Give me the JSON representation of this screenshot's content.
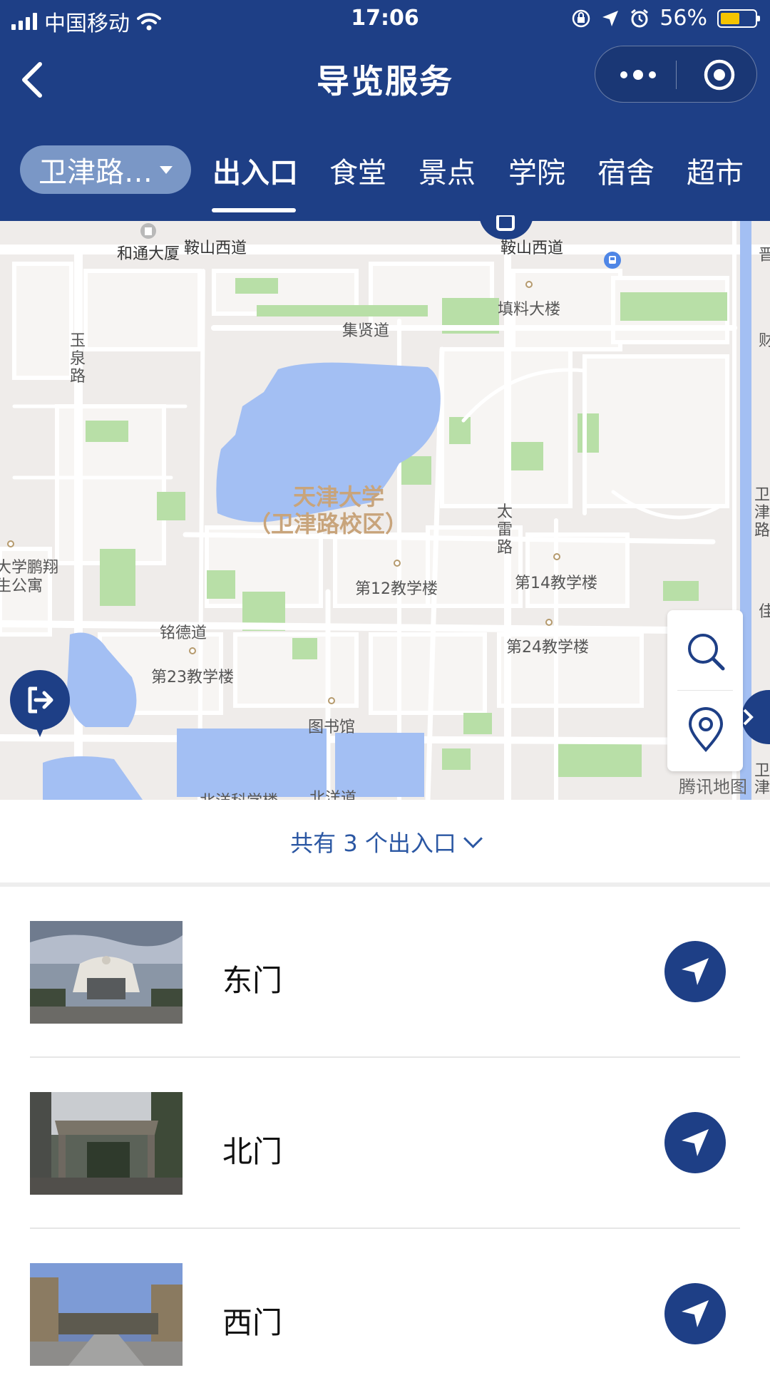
{
  "status_bar": {
    "carrier": "中国移动",
    "time": "17:06",
    "battery": "56%",
    "battery_level": 0.56,
    "icons": [
      "signal-icon",
      "wifi-icon",
      "lock-rotation-icon",
      "location-arrow-icon",
      "alarm-icon",
      "battery-icon"
    ]
  },
  "nav": {
    "title": "导览服务",
    "back_icon": "chevron-left-icon",
    "more_icon": "more-dots-icon",
    "close_icon": "target-circle-icon"
  },
  "campus_selector": {
    "label": "卫津路…"
  },
  "tabs": [
    {
      "label": "出入口",
      "active": true
    },
    {
      "label": "食堂"
    },
    {
      "label": "景点"
    },
    {
      "label": "学院"
    },
    {
      "label": "宿舍"
    },
    {
      "label": "超市"
    }
  ],
  "map": {
    "campus_name_line1": "天津大学",
    "campus_name_line2": "（卫津路校区）",
    "labels": {
      "hetong": "和通大厦",
      "anshan_west": "鞍山西道",
      "anshan_west_2": "鞍山西道",
      "tianliao": "填料大楼",
      "jixian": "集贤道",
      "yuquan": "玉泉路",
      "tailei": "太雷路",
      "building12": "第12教学楼",
      "building14": "第14教学楼",
      "building23": "第23教学楼",
      "building24": "第24教学楼",
      "mingde": "铭德道",
      "library": "图书馆",
      "pengxiang_1": "大学鹏翔",
      "pengxiang_2": "生公寓",
      "beiyang_bldg": "北洋科学楼",
      "beiyang_rd": "北洋道",
      "weijin_rd": "卫津路",
      "edge_jin": "晋",
      "edge_jia": "佳",
      "edge_ji": "财",
      "edge_wei": "卫津"
    },
    "watermark": "腾讯地图",
    "tools": [
      "search-icon",
      "location-pin-icon"
    ],
    "markers": [
      "exit-marker-icon",
      "exit-marker-icon"
    ]
  },
  "summary": {
    "text": "共有 3 个出入口",
    "icon": "chevron-down-icon"
  },
  "entrances": [
    {
      "name": "东门",
      "thumb": "east-gate-photo",
      "action_icon": "navigate-arrow-icon"
    },
    {
      "name": "北门",
      "thumb": "north-gate-photo",
      "action_icon": "navigate-arrow-icon"
    },
    {
      "name": "西门",
      "thumb": "west-gate-photo",
      "action_icon": "navigate-arrow-icon"
    }
  ],
  "colors": {
    "primary": "#1e3f86",
    "accent_text": "#2b57a3",
    "map_water": "#a3bff3",
    "map_green": "#b8dfa7",
    "map_land": "#efecea",
    "campus_label": "#c8a47b",
    "battery_fill": "#f5c400"
  }
}
